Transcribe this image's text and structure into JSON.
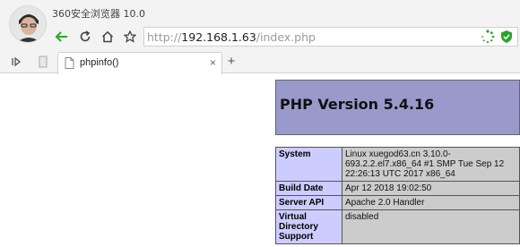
{
  "window": {
    "title": "360安全浏览器 10.0"
  },
  "address_bar": {
    "url_scheme": "http://",
    "url_host": "192.168.1.63",
    "url_path": "/index.php"
  },
  "tabs": [
    {
      "title": "phpinfo()",
      "close_label": "×"
    }
  ],
  "new_tab_label": "+",
  "page": {
    "heading": "PHP Version 5.4.16",
    "rows": [
      {
        "key": "System",
        "value": "Linux xuegod63.cn 3.10.0-693.2.2.el7.x86_64 #1 SMP Tue Sep 12 22:26:13 UTC 2017 x86_64"
      },
      {
        "key": "Build Date",
        "value": "Apr 12 2018 19:02:50"
      },
      {
        "key": "Server API",
        "value": "Apache 2.0 Handler"
      },
      {
        "key": "Virtual Directory Support",
        "value": "disabled"
      }
    ]
  },
  "colors": {
    "accent_green": "#2aa52a",
    "php_header": "#9999cc",
    "key_cell": "#ccccff",
    "value_cell": "#cccccc"
  }
}
